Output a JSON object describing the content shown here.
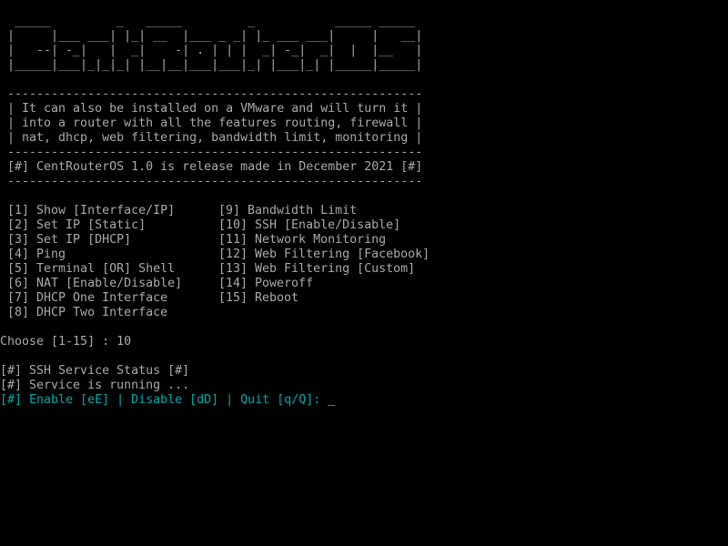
{
  "colors": {
    "background": "#000000",
    "text": "#aaaaaa",
    "prompt": "#00aaaa"
  },
  "logo": {
    "lines": [
      "  _____         _   _____         _           _____ _____ ",
      " |     |___ ___| |_| __  |___ _ _| |_ ___ ___|     |   __|",
      " |   --| -_|   |  _|    -| . | | |  _| -_|  _|  |  |__   |",
      " |_____|___|_|_|_| |__|__|___|___|_| |___|_| |_____|_____|"
    ]
  },
  "banner": {
    "rule": " ---------------------------------------------------------",
    "lines": [
      " | It can also be installed on a VMware and will turn it |",
      " | into a router with all the features routing, firewall |",
      " | nat, dhcp, web filtering, bandwidth limit, monitoring |"
    ],
    "release": " [#] CentRouterOS 1.0 is release made in December 2021 [#]"
  },
  "menu": {
    "left": [
      " [1] Show [Interface/IP]",
      " [2] Set IP [Static]",
      " [3] Set IP [DHCP]",
      " [4] Ping",
      " [5] Terminal [OR] Shell",
      " [6] NAT [Enable/Disable]",
      " [7] DHCP One Interface",
      " [8] DHCP Two Interface"
    ],
    "right": [
      "[9] Bandwidth Limit",
      "[10] SSH [Enable/Disable]",
      "[11] Network Monitoring",
      "[12] Web Filtering [Facebook]",
      "[13] Web Filtering [Custom]",
      "[14] Poweroff",
      "[15] Reboot"
    ]
  },
  "choose": {
    "prompt": "Choose [1-15] : ",
    "value": "10"
  },
  "status": {
    "title": "[#] SSH Service Status [#]",
    "message": "[#] Service is running ...",
    "prompt": "[#] Enable [eE] | Disable [dD] | Quit [q/Q]: ",
    "cursor": "_"
  }
}
